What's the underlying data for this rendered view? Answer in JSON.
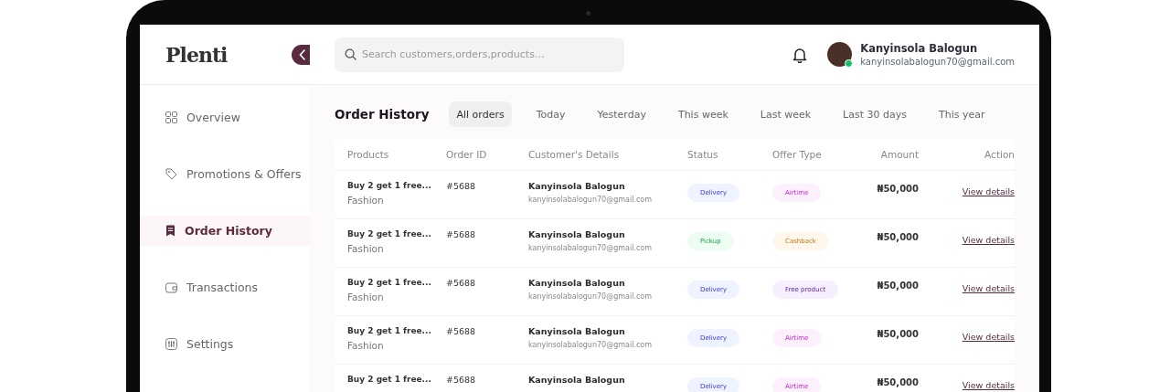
{
  "brand": {
    "name": "Plenti"
  },
  "search": {
    "placeholder": "Search customers,orders,products..."
  },
  "user": {
    "name": "Kanyinsola Balogun",
    "email": "kanyinsolabalogun70@gmail.com",
    "online": true
  },
  "sidebar": {
    "items": [
      {
        "label": "Overview",
        "selected": false
      },
      {
        "label": "Promotions & Offers",
        "selected": false
      },
      {
        "label": "Order History",
        "selected": true
      },
      {
        "label": "Transactions",
        "selected": false
      },
      {
        "label": "Settings",
        "selected": false
      }
    ]
  },
  "page": {
    "title": "Order History"
  },
  "tabs": [
    {
      "label": "All orders",
      "selected": true
    },
    {
      "label": "Today",
      "selected": false
    },
    {
      "label": "Yesterday",
      "selected": false
    },
    {
      "label": "This week",
      "selected": false
    },
    {
      "label": "Last week",
      "selected": false
    },
    {
      "label": "Last 30 days",
      "selected": false
    },
    {
      "label": "This year",
      "selected": false
    }
  ],
  "table": {
    "columns": [
      "Products",
      "Order ID",
      "Customer's Details",
      "Status",
      "Offer Type",
      "Amount",
      "Action"
    ],
    "rows": [
      {
        "product": "Buy 2 get 1 free...",
        "category": "Fashion",
        "order_id": "#5688",
        "customer": "Kanyinsola Balogun",
        "email": "kanyinsolabalogun70@gmail.com",
        "status": {
          "label": "Delivery",
          "kind": "delivery"
        },
        "offer": {
          "label": "Airtime",
          "kind": "airtime"
        },
        "amount": "₦50,000",
        "action": "View details"
      },
      {
        "product": "Buy 2 get 1 free...",
        "category": "Fashion",
        "order_id": "#5688",
        "customer": "Kanyinsola Balogun",
        "email": "kanyinsolabalogun70@gmail.com",
        "status": {
          "label": "Pickup",
          "kind": "pickup"
        },
        "offer": {
          "label": "Cashback",
          "kind": "cashback"
        },
        "amount": "₦50,000",
        "action": "View details"
      },
      {
        "product": "Buy 2 get 1 free...",
        "category": "Fashion",
        "order_id": "#5688",
        "customer": "Kanyinsola Balogun",
        "email": "kanyinsolabalogun70@gmail.com",
        "status": {
          "label": "Delivery",
          "kind": "delivery"
        },
        "offer": {
          "label": "Free product",
          "kind": "product"
        },
        "amount": "₦50,000",
        "action": "View details"
      },
      {
        "product": "Buy 2 get 1 free...",
        "category": "Fashion",
        "order_id": "#5688",
        "customer": "Kanyinsola Balogun",
        "email": "kanyinsolabalogun70@gmail.com",
        "status": {
          "label": "Delivery",
          "kind": "delivery"
        },
        "offer": {
          "label": "Airtime",
          "kind": "airtime"
        },
        "amount": "₦50,000",
        "action": "View details"
      },
      {
        "product": "Buy 2 get 1 free...",
        "order_id": "#5688",
        "customer": "Kanyinsola Balogun",
        "status": {
          "label": "Delivery",
          "kind": "delivery"
        },
        "offer": {
          "label": "Airtime",
          "kind": "airtime"
        },
        "amount": "₦50,000",
        "action": "View details"
      }
    ]
  }
}
